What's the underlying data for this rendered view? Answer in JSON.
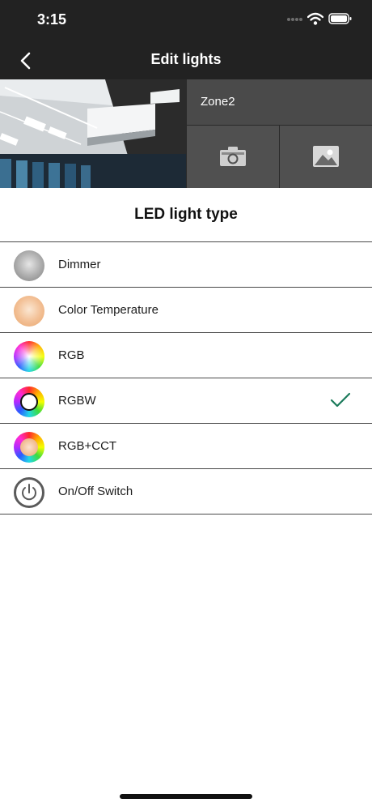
{
  "status_bar": {
    "time": "3:15"
  },
  "header": {
    "title": "Edit lights"
  },
  "zone": {
    "name": "Zone2"
  },
  "section": {
    "title": "LED light type"
  },
  "light_types": [
    {
      "label": "Dimmer",
      "icon": "dimmer-icon",
      "selected": false
    },
    {
      "label": "Color Temperature",
      "icon": "color-temperature-icon",
      "selected": false
    },
    {
      "label": "RGB",
      "icon": "rgb-color-wheel-icon",
      "selected": false
    },
    {
      "label": "RGBW",
      "icon": "rgbw-color-wheel-icon",
      "selected": true
    },
    {
      "label": "RGB+CCT",
      "icon": "rgb-cct-color-wheel-icon",
      "selected": false
    },
    {
      "label": "On/Off Switch",
      "icon": "power-icon",
      "selected": false
    }
  ],
  "colors": {
    "header_bg": "#222222",
    "check": "#1a7a5a",
    "panel": "#4a4a4a"
  }
}
